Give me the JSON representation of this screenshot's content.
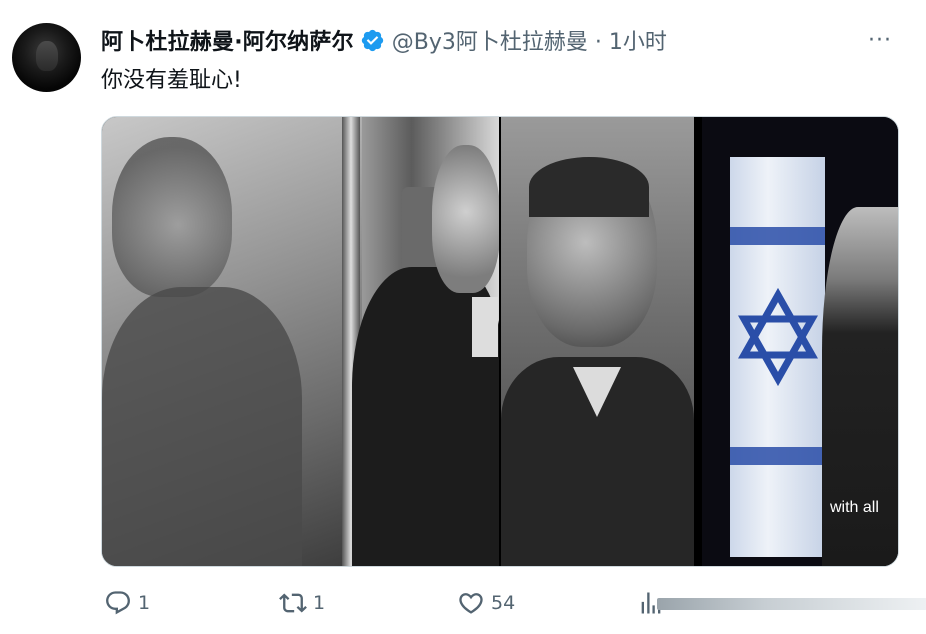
{
  "author": {
    "display_name": "阿卜杜拉赫曼·阿尔纳萨尔",
    "handle_line": "@By3阿卜杜拉赫曼 · 1小时",
    "verified": true,
    "verified_color": "#1d9bf0",
    "avatar_icon": "avatar-photo"
  },
  "more_label": "···",
  "tweet": {
    "text": "你没有羞耻心!"
  },
  "media": {
    "caption": "with all"
  },
  "actions": {
    "reply": {
      "icon": "reply-icon",
      "count": "1"
    },
    "retweet": {
      "icon": "retweet-icon",
      "count": "1"
    },
    "like": {
      "icon": "heart-icon",
      "count": "54"
    },
    "views": {
      "icon": "views-icon"
    }
  },
  "colors": {
    "text": "#0f1419",
    "secondary": "#536471",
    "border": "#cfd9de"
  }
}
